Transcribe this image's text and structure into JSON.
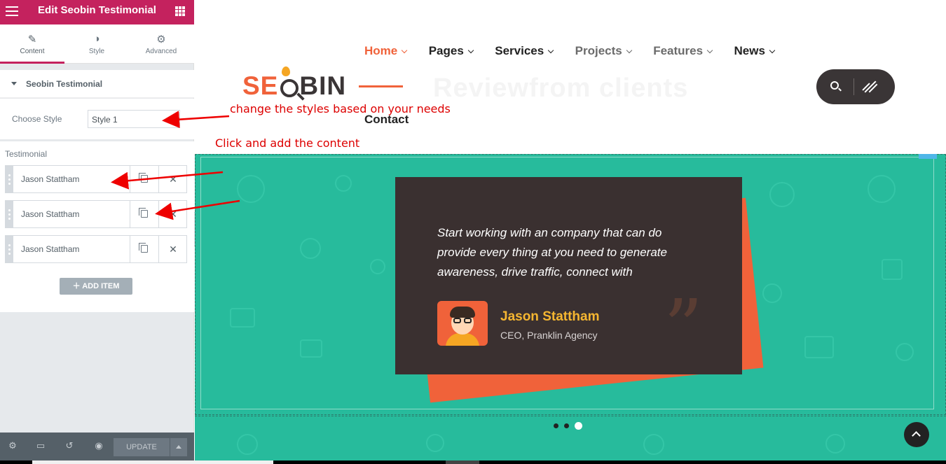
{
  "panel": {
    "title": "Edit Seobin Testimonial",
    "tabs": [
      {
        "label": "Content",
        "icon": "pencil-icon"
      },
      {
        "label": "Style",
        "icon": "contrast-icon"
      },
      {
        "label": "Advanced",
        "icon": "gear-icon"
      }
    ],
    "section_title": "Seobin Testimonial",
    "choose_style_label": "Choose Style",
    "choose_style_value": "Style 1",
    "repeater_label": "Testimonial",
    "items": [
      {
        "name": "Jason Stattham"
      },
      {
        "name": "Jason Stattham"
      },
      {
        "name": "Jason Stattham"
      }
    ],
    "add_item_label": "ADD ITEM",
    "footer": {
      "update_label": "UPDATE",
      "icons": [
        "gear-icon",
        "desktop-icon",
        "history-icon",
        "eye-icon"
      ]
    }
  },
  "site": {
    "logo_text_a": "SE",
    "logo_text_b": "BIN",
    "nav": [
      {
        "label": "Home"
      },
      {
        "label": "Pages"
      },
      {
        "label": "Services"
      },
      {
        "label": "Projects"
      },
      {
        "label": "Features"
      },
      {
        "label": "News"
      }
    ],
    "nav_contact": "Contact",
    "background_title": "Reviewfrom clients",
    "testimonial": {
      "quote": "Start working with an company that can do provide every thing at you need to generate awareness, drive traffic, connect with",
      "name": "Jason Stattham",
      "role": "CEO, Pranklin Agency"
    }
  },
  "annotations": {
    "styles_note": "change the styles based on your needs",
    "content_note": "Click and add the content"
  },
  "colors": {
    "editor_accent": "#c4225e",
    "brand_orange": "#f0623a",
    "section_teal": "#27bb9c",
    "card_dark": "#3a3030",
    "name_gold": "#f5b631",
    "annotation_red": "#dd0000"
  }
}
